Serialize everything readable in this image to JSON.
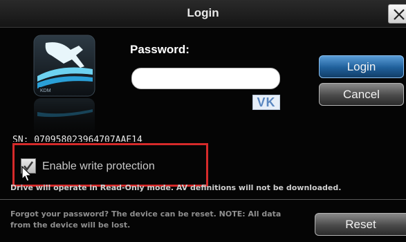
{
  "window": {
    "title": "Login",
    "close_icon": "close-icon"
  },
  "brand": {
    "logo_text": "KDM"
  },
  "form": {
    "password_label": "Password:",
    "password_value": "",
    "virtual_keyboard_label": "VK"
  },
  "buttons": {
    "login": "Login",
    "cancel": "Cancel",
    "reset": "Reset"
  },
  "serial_number": "SN: 070958023964707AAE14",
  "write_protection": {
    "label": "Enable write protection",
    "checked": true,
    "info": "Drive will operate in Read-Only mode. AV definitions will not be downloaded."
  },
  "reset_note": "Forgot your password? The device can be reset. NOTE: All data from the device will be lost.",
  "colors": {
    "accent_blue": "#2a6fb0",
    "highlight_red": "#d62a2a",
    "background": "#050505"
  }
}
